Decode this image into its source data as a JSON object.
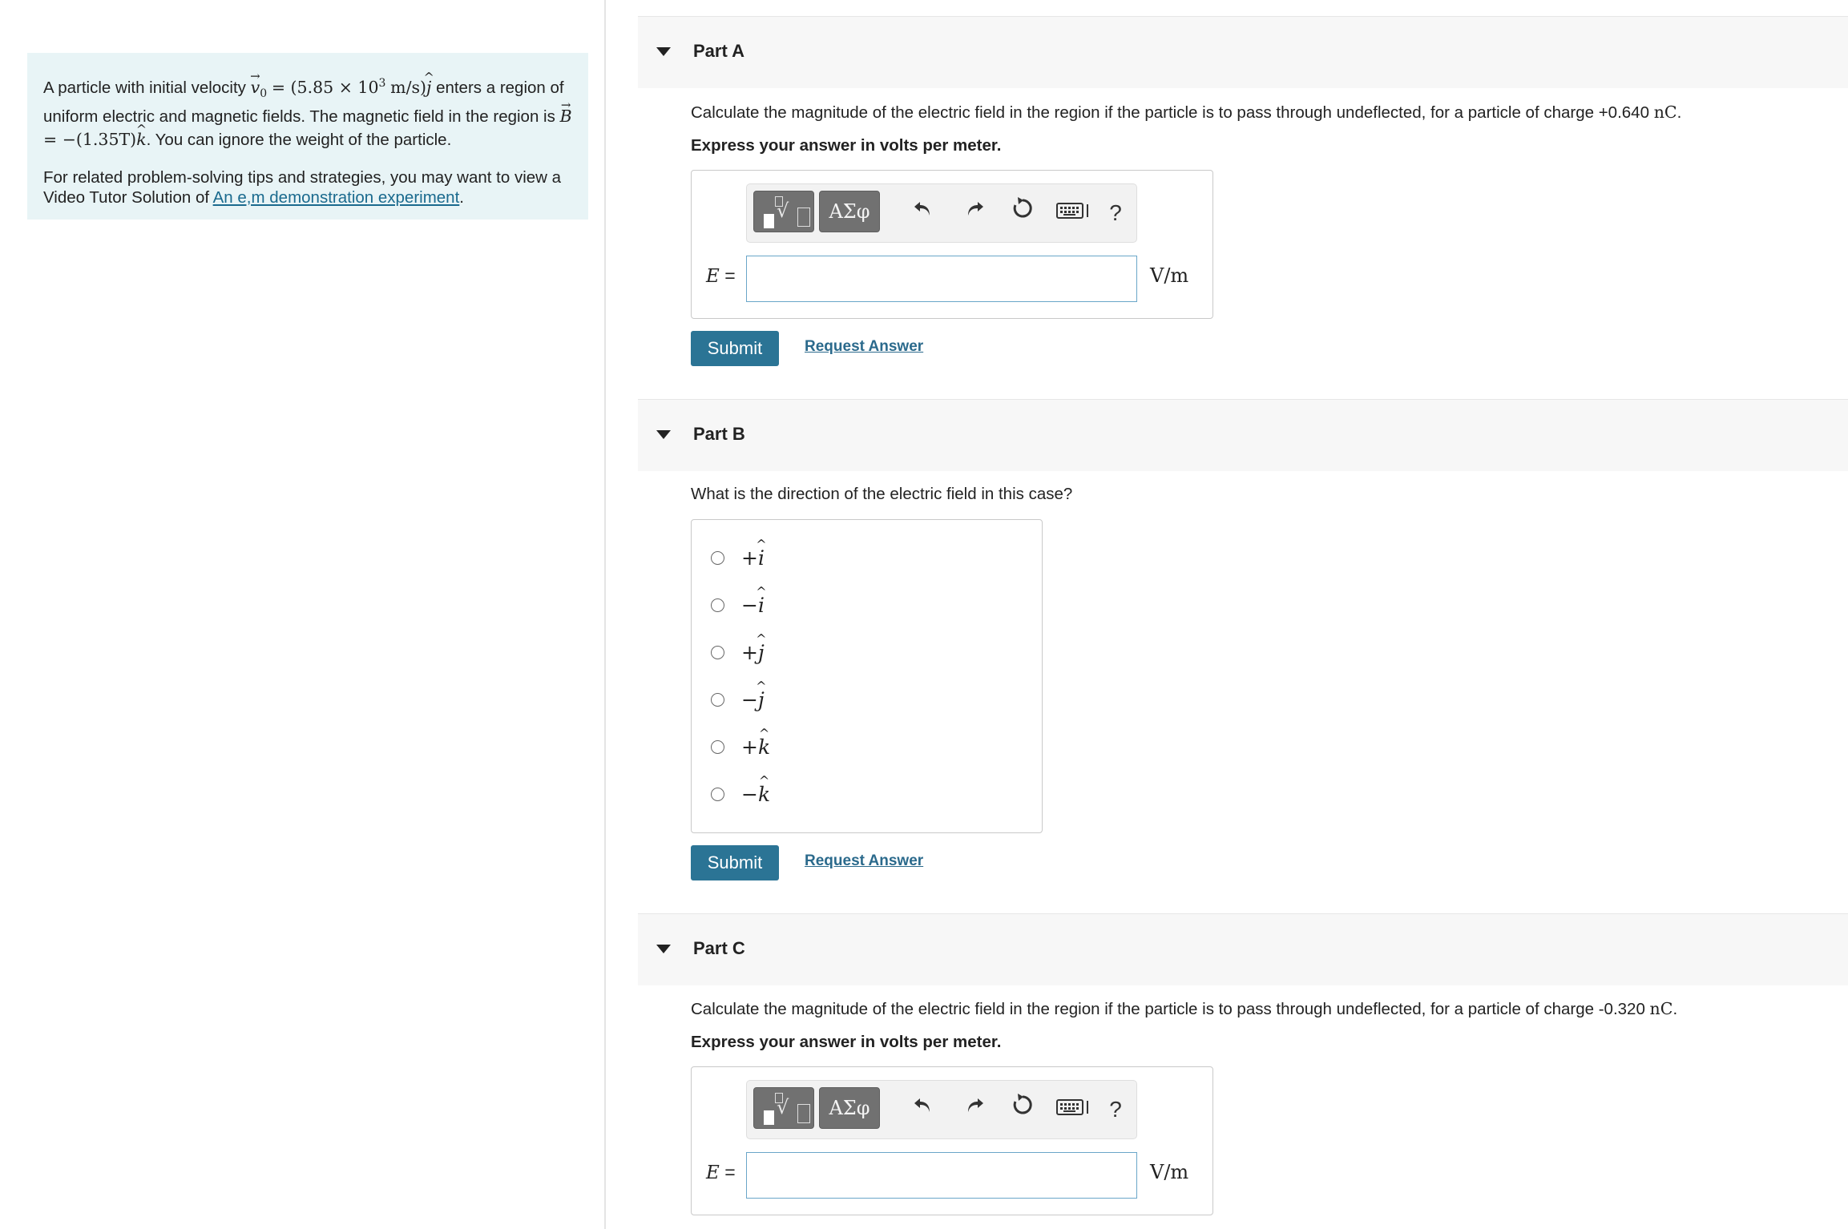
{
  "problem": {
    "intro_pre": "A particle with initial velocity",
    "v_symbol": "v",
    "v_subscript": "0",
    "v_eq": "= (5.85 × 10",
    "v_exp": "3",
    "v_units": "m/s)",
    "unit_j": "j",
    "intro_mid": "enters a region of uniform electric and magnetic fields. The magnetic field in the region is",
    "b_symbol": "B",
    "b_eq": "= −(1.35T)",
    "unit_k": "k",
    "intro_end": ". You can ignore the weight of the particle.",
    "tips_pre": "For related problem-solving tips and strategies, you may want to view a Video Tutor Solution of",
    "tips_link": "An e,m demonstration experiment",
    "tips_end": "."
  },
  "part_a": {
    "title": "Part A",
    "question_pre": "Calculate the magnitude of the electric field in the region if the particle is to pass through undeflected, for a particle of charge +0.640",
    "question_unit": "nC",
    "question_end": ".",
    "instruction": "Express your answer in volts per meter.",
    "answer_label": "E",
    "answer_eq": "=",
    "unit": "V/m",
    "answer_value": "",
    "submit": "Submit",
    "request": "Request Answer"
  },
  "part_b": {
    "title": "Part B",
    "question": "What is the direction of the electric field in this case?",
    "options": [
      {
        "sign": "+",
        "unit": "i"
      },
      {
        "sign": "−",
        "unit": "i"
      },
      {
        "sign": "+",
        "unit": "j"
      },
      {
        "sign": "−",
        "unit": "j"
      },
      {
        "sign": "+",
        "unit": "k"
      },
      {
        "sign": "−",
        "unit": "k"
      }
    ],
    "submit": "Submit",
    "request": "Request Answer"
  },
  "part_c": {
    "title": "Part C",
    "question_pre": "Calculate the magnitude of the electric field in the region if the particle is to pass through undeflected, for a particle of charge -0.320",
    "question_unit": "nC",
    "question_end": ".",
    "instruction": "Express your answer in volts per meter.",
    "answer_label": "E",
    "answer_eq": "=",
    "unit": "V/m",
    "answer_value": ""
  },
  "toolbar": {
    "symbols_label": "ΑΣφ",
    "help_label": "?",
    "icons": [
      "templates-icon",
      "greek-symbols-icon",
      "undo-icon",
      "redo-icon",
      "reset-icon",
      "keyboard-icon",
      "help-icon"
    ]
  },
  "colors": {
    "panel_bg": "#e8f4f6",
    "accent": "#2b7495",
    "link": "#1a6a8e",
    "header_bg": "#f7f7f7"
  }
}
